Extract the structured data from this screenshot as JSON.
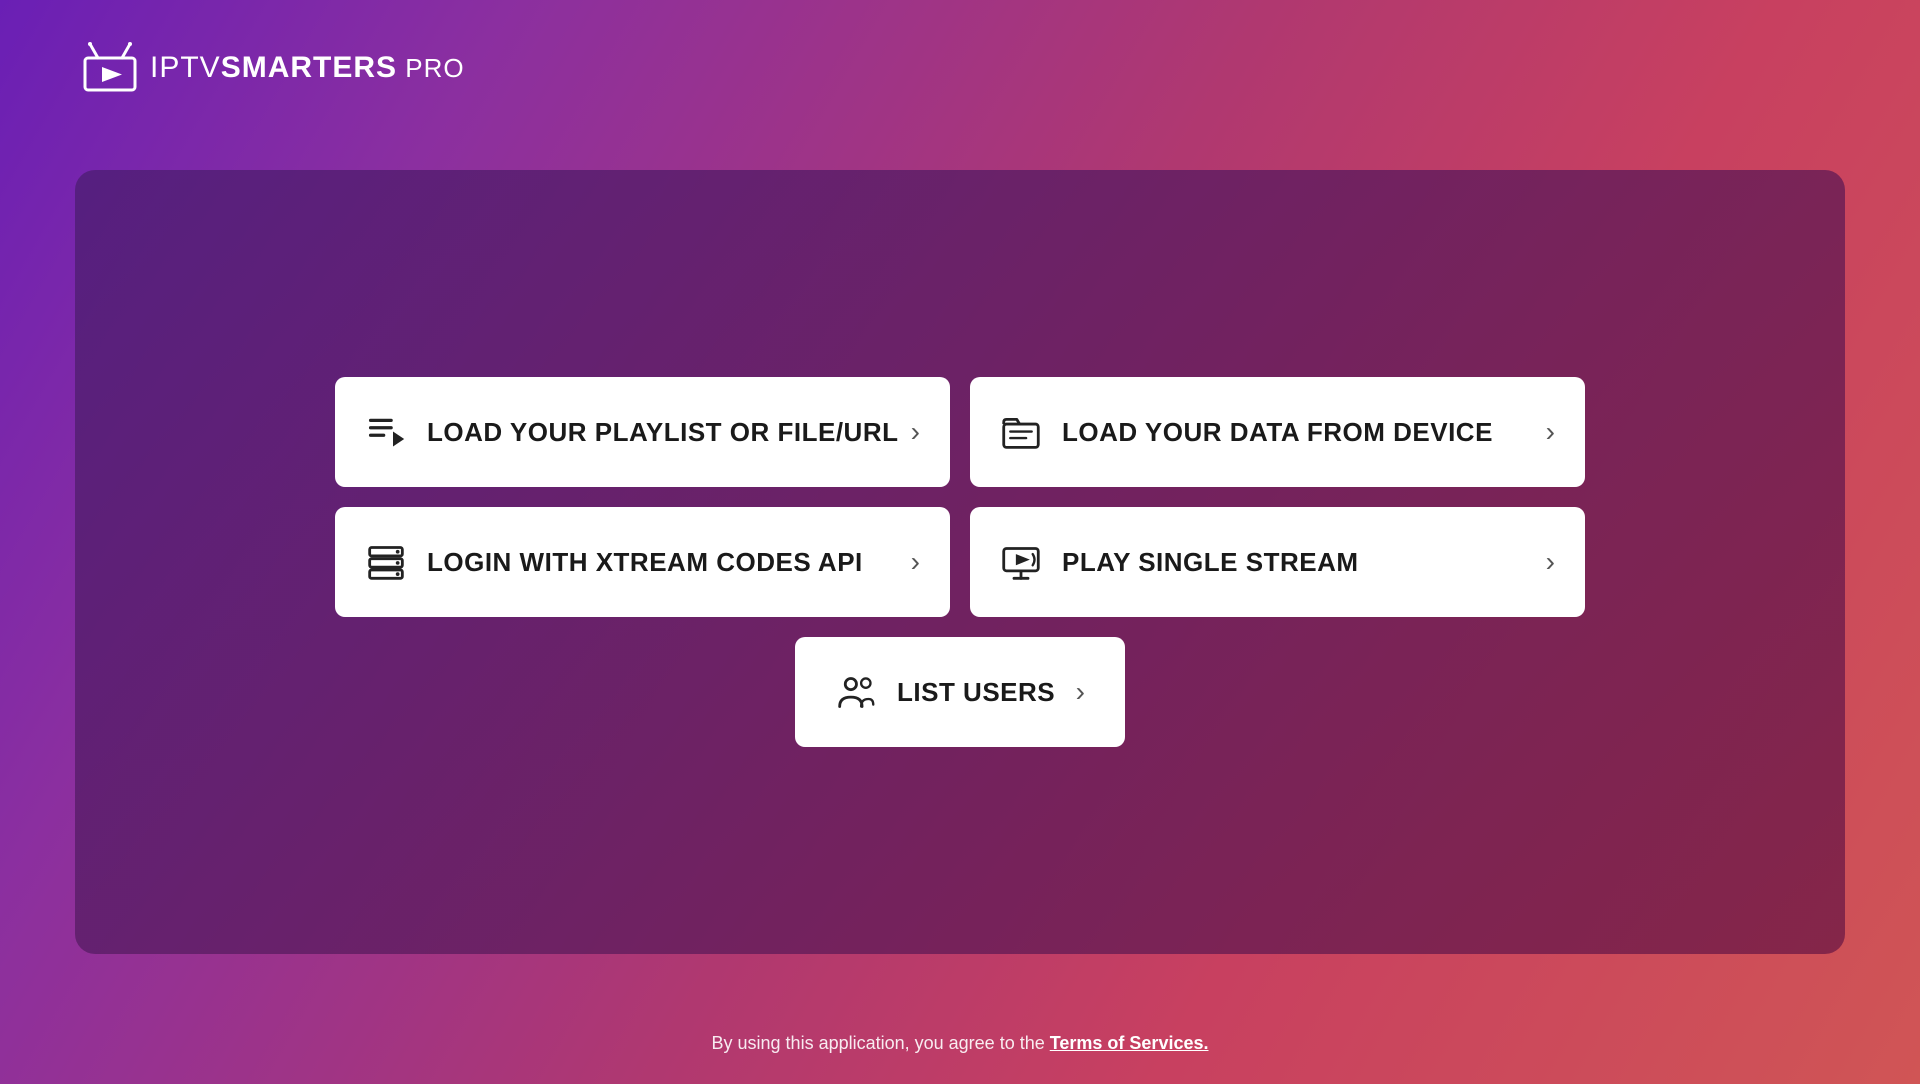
{
  "app": {
    "name": "IPTV",
    "name_bold": "SMARTERS",
    "name_suffix": " PRO"
  },
  "menu": {
    "buttons": [
      {
        "id": "load-playlist",
        "label": "LOAD YOUR PLAYLIST OR FILE/URL",
        "icon": "playlist-icon"
      },
      {
        "id": "load-device",
        "label": "LOAD YOUR DATA FROM DEVICE",
        "icon": "device-icon"
      },
      {
        "id": "login-xtream",
        "label": "LOGIN WITH XTREAM CODES API",
        "icon": "xtream-icon"
      },
      {
        "id": "play-stream",
        "label": "PLAY SINGLE STREAM",
        "icon": "stream-icon"
      }
    ],
    "center_button": {
      "id": "list-users",
      "label": "LIST USERS",
      "icon": "users-icon"
    }
  },
  "footer": {
    "text": "By using this application, you agree to the ",
    "link_text": "Terms of Services."
  },
  "colors": {
    "background_start": "#7b2ff7",
    "background_end": "#d05050",
    "card_bg": "rgba(80,30,120,0.85)",
    "button_bg": "#ffffff",
    "text_dark": "#1a1a1a",
    "accent": "#ffffff"
  }
}
